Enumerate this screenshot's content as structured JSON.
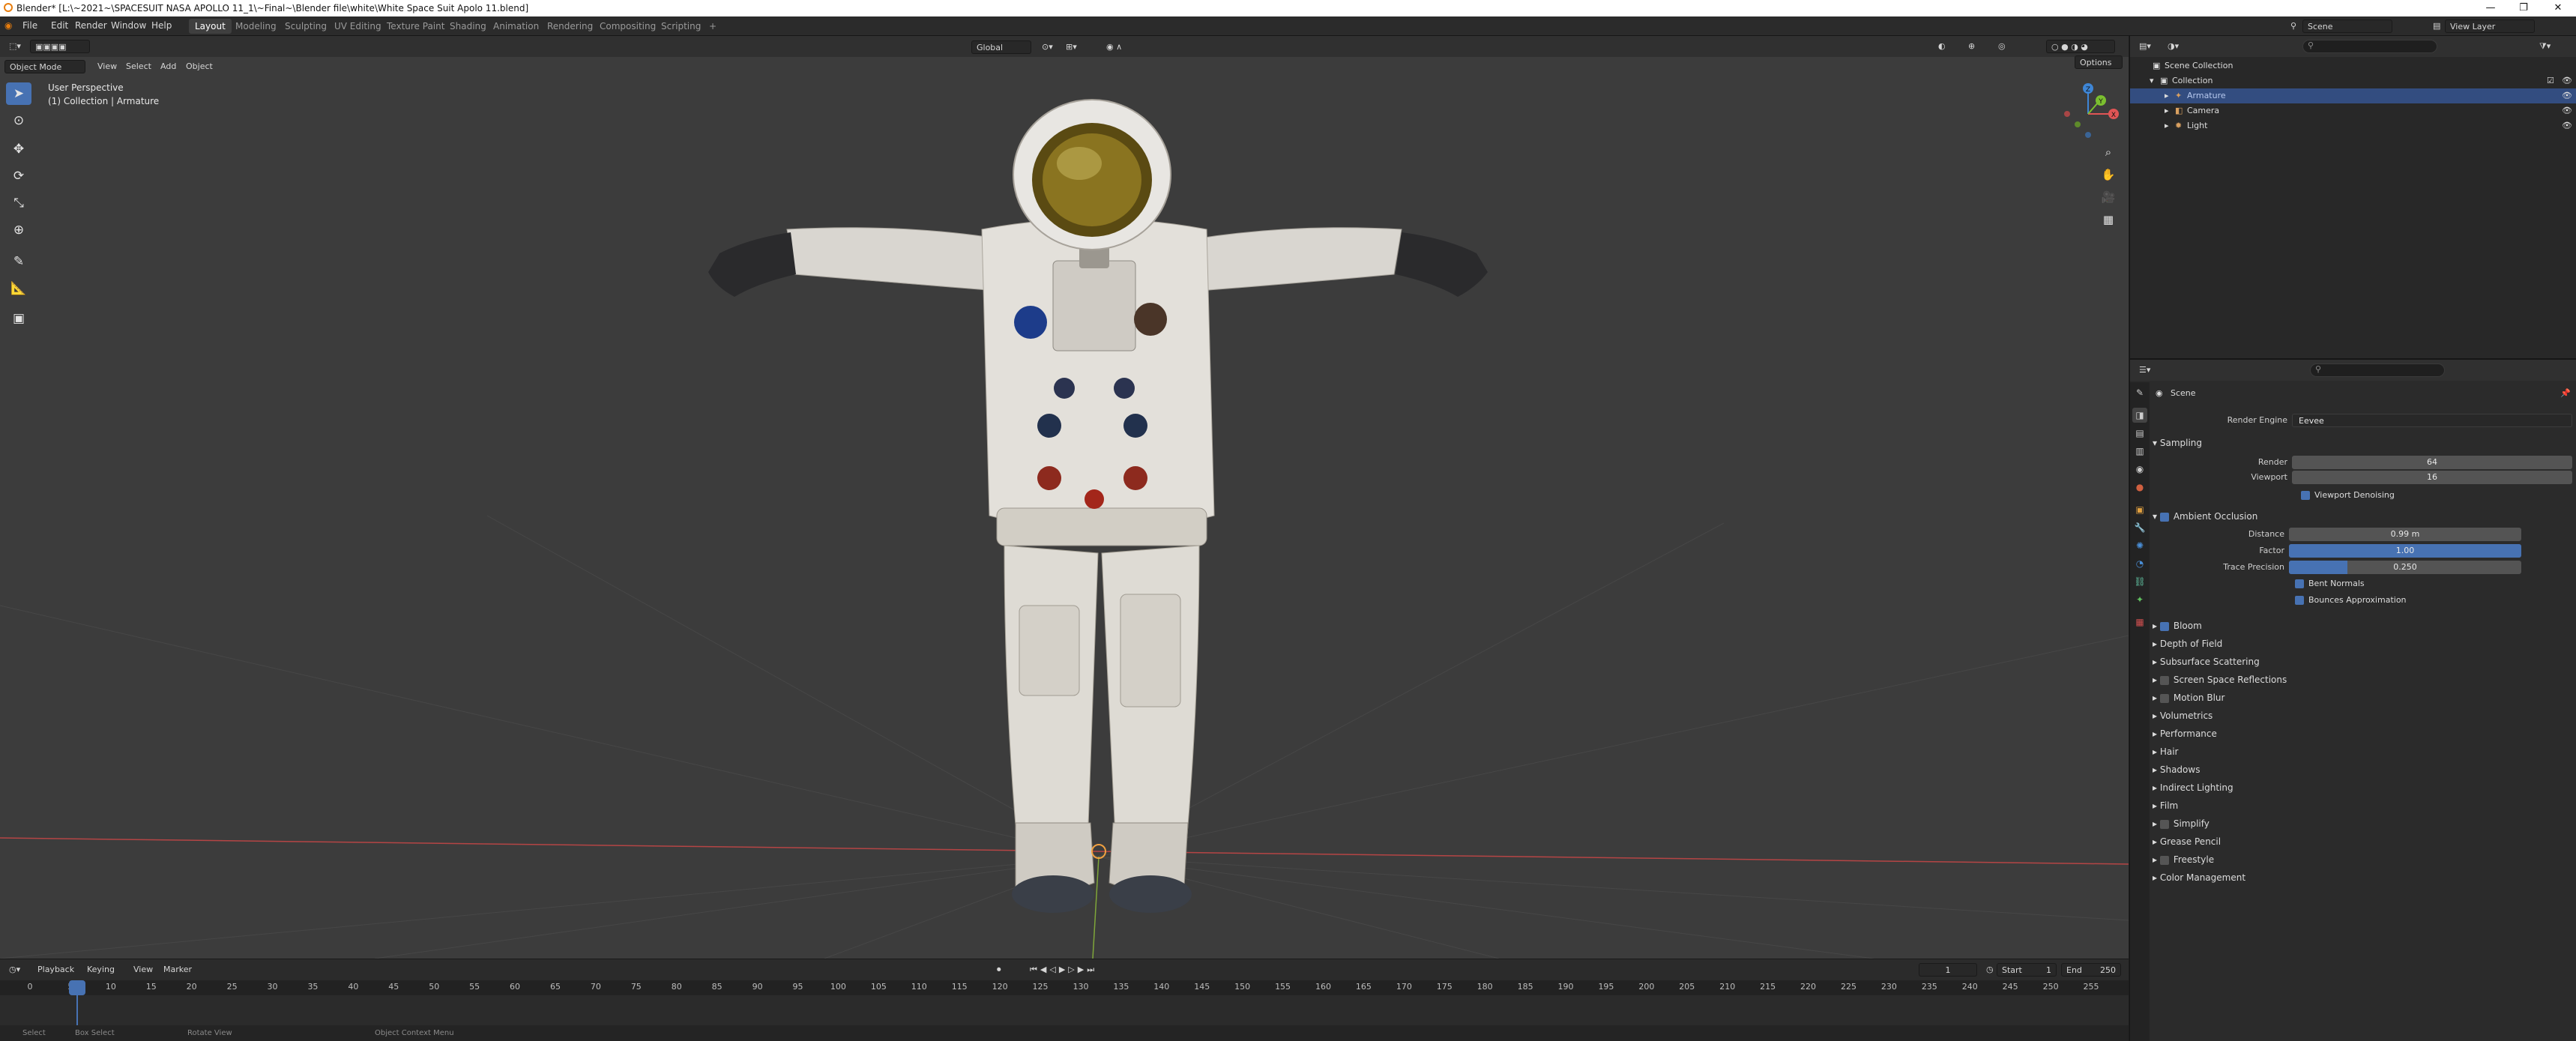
{
  "window": {
    "title": "Blender* [L:\\~2021~\\SPACESUIT NASA APOLLO 11_1\\~Final~\\Blender file\\white\\White Space Suit Apolo 11.blend]",
    "controls": [
      "—",
      "❐",
      "✕"
    ]
  },
  "menu": [
    "File",
    "Edit",
    "Render",
    "Window",
    "Help"
  ],
  "workspaces": [
    "Layout",
    "Modeling",
    "Sculpting",
    "UV Editing",
    "Texture Paint",
    "Shading",
    "Animation",
    "Rendering",
    "Compositing",
    "Scripting",
    "+"
  ],
  "active_workspace": "Layout",
  "scene": {
    "name": "Scene",
    "view_layer": "View Layer"
  },
  "viewport": {
    "mode": "Object Mode",
    "menus": [
      "View",
      "Select",
      "Add",
      "Object"
    ],
    "orientation": "Global",
    "options_label": "Options",
    "overlay_line1": "User Perspective",
    "overlay_line2": "(1) Collection | Armature",
    "axis_x_color": "#e05555",
    "axis_y_color": "#7bbf2f",
    "axis_z_color": "#3e86d6",
    "gizmo_labels": {
      "x": "X",
      "y": "Y",
      "z": "Z"
    }
  },
  "timeline": {
    "menus": [
      "Playback",
      "Keying",
      "View",
      "Marker"
    ],
    "current_frame": "1",
    "start_label": "Start",
    "start": "1",
    "end_label": "End",
    "end": "250",
    "ticks": [
      "0",
      "1",
      "5",
      "10",
      "15",
      "20",
      "25",
      "30",
      "35",
      "40",
      "45",
      "50",
      "55",
      "60",
      "65",
      "70",
      "75",
      "80",
      "85",
      "90",
      "95",
      "100",
      "105",
      "110",
      "115",
      "120",
      "125",
      "130",
      "135",
      "140",
      "145",
      "150",
      "155",
      "160",
      "165",
      "170",
      "175",
      "180",
      "185",
      "190",
      "195",
      "200",
      "205",
      "210",
      "215",
      "220",
      "225",
      "230",
      "235",
      "240",
      "245",
      "250",
      "255"
    ],
    "playhead_color": "#4772b3",
    "status": [
      "Select",
      "Box Select",
      "Rotate View",
      "Object Context Menu"
    ]
  },
  "outliner": {
    "items": [
      {
        "label": "Scene Collection",
        "level": 0
      },
      {
        "label": "Collection",
        "level": 1
      },
      {
        "label": "Armature",
        "level": 2,
        "selected": true
      },
      {
        "label": "Camera",
        "level": 2
      },
      {
        "label": "Light",
        "level": 2
      }
    ]
  },
  "properties": {
    "scene_label": "Scene",
    "render_engine_label": "Render Engine",
    "render_engine": "Eevee",
    "sampling": {
      "title": "Sampling",
      "render_label": "Render",
      "render": "64",
      "viewport_label": "Viewport",
      "viewport": "16",
      "denoise_label": "Viewport Denoising"
    },
    "ambient_occlusion": {
      "title": "Ambient Occlusion",
      "distance_label": "Distance",
      "distance": "0.99 m",
      "factor_label": "Factor",
      "factor": "1.00",
      "factor_fill": 1.0,
      "trace_label": "Trace Precision",
      "trace": "0.250",
      "trace_fill": 0.25,
      "bent_normals": "Bent Normals",
      "bounces": "Bounces Approximation"
    },
    "panels": [
      {
        "label": "Bloom",
        "checkbox": true
      },
      {
        "label": "Depth of Field",
        "checkbox": false
      },
      {
        "label": "Subsurface Scattering",
        "checkbox": false
      },
      {
        "label": "Screen Space Reflections",
        "checkbox": true
      },
      {
        "label": "Motion Blur",
        "checkbox": true
      },
      {
        "label": "Volumetrics",
        "checkbox": false
      },
      {
        "label": "Performance",
        "checkbox": false
      },
      {
        "label": "Hair",
        "checkbox": false
      },
      {
        "label": "Shadows",
        "checkbox": false
      },
      {
        "label": "Indirect Lighting",
        "checkbox": false
      },
      {
        "label": "Film",
        "checkbox": false
      },
      {
        "label": "Simplify",
        "checkbox": true
      },
      {
        "label": "Grease Pencil",
        "checkbox": false
      },
      {
        "label": "Freestyle",
        "checkbox": true
      },
      {
        "label": "Color Management",
        "checkbox": false
      }
    ]
  },
  "colors": {
    "accent": "#4772b3",
    "header": "#303030",
    "viewport_bg": "#3c3c3c",
    "panel_bg": "#2b2b2b",
    "blender_orange": "#e87d0d"
  }
}
